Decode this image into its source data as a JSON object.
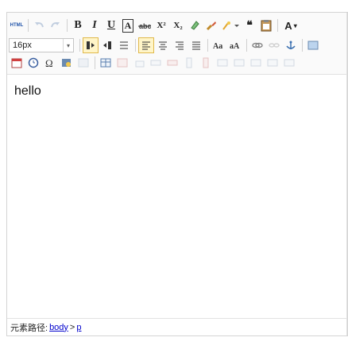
{
  "toolbar": {
    "source_label": "HTML",
    "bold_label": "B",
    "italic_label": "I",
    "underline_label": "U",
    "fontborder_label": "A",
    "superscript_label": "X²",
    "subscript_label": "X₂",
    "blockquote_label": "❝",
    "forecolor_label": "A",
    "font_size": {
      "value": "16px"
    },
    "accent_color": "#e0b84a"
  },
  "content": {
    "text": "hello"
  },
  "statusbar": {
    "path_label": "元素路径:",
    "path_body": "body",
    "path_sep": ">",
    "path_p": "p"
  }
}
